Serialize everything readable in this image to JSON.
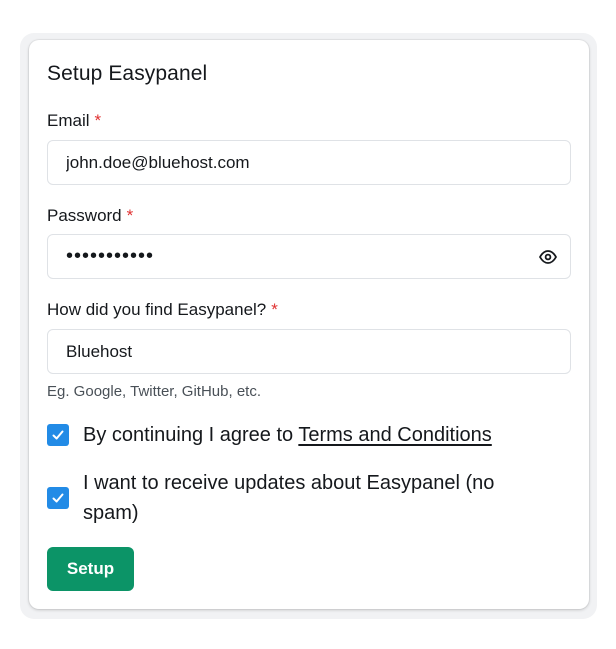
{
  "form": {
    "title": "Setup Easypanel",
    "required_mark": "*",
    "email": {
      "label": "Email",
      "value": "john.doe@bluehost.com"
    },
    "password": {
      "label": "Password",
      "value": "•••••••••••",
      "toggle_icon": "eye-icon"
    },
    "source": {
      "label": "How did you find Easypanel?",
      "value": "Bluehost",
      "hint": "Eg. Google, Twitter, GitHub, etc."
    },
    "terms": {
      "checked": true,
      "prefix": "By continuing I agree to ",
      "link": "Terms and Conditions"
    },
    "updates": {
      "checked": true,
      "label": "I want to receive updates about Easypanel (no spam)"
    },
    "submit_label": "Setup"
  },
  "colors": {
    "accent": "#228be6",
    "button": "#0c9467",
    "required": "#e03131"
  }
}
